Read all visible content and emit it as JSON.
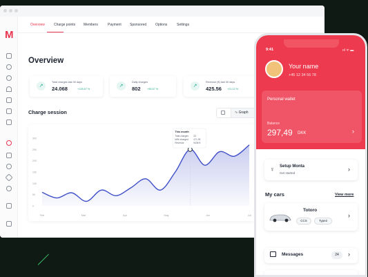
{
  "app": {
    "logo": "M",
    "tabs": [
      {
        "label": "Overview"
      },
      {
        "label": "Charge points"
      },
      {
        "label": "Members"
      },
      {
        "label": "Payment"
      },
      {
        "label": "Sponsored"
      },
      {
        "label": "Options"
      },
      {
        "label": "Settings"
      }
    ],
    "active_tab": "Overview"
  },
  "overview": {
    "title": "Overview",
    "cards": [
      {
        "label": "Total charges last 30 days",
        "value": "24.068",
        "change": "+126.67 %"
      },
      {
        "label": "Daily charges",
        "value": "802",
        "change": "+96.67 %"
      },
      {
        "label": "Revenue (€) last 30 days",
        "value": "425.56",
        "change": "+21.12 %"
      }
    ],
    "charge_session_title": "Charge session",
    "graph_label": "Graph"
  },
  "chart_data": {
    "type": "area",
    "x_labels": [
      "Feb",
      "Mar",
      "Apr",
      "May",
      "Jun",
      "Jul"
    ],
    "y_ticks": [
      "0",
      "50",
      "100",
      "150",
      "200",
      "250",
      "300"
    ],
    "ylim": [
      0,
      300
    ],
    "values": [
      60,
      35,
      58,
      20,
      70,
      45,
      80,
      120,
      70,
      150,
      250,
      180,
      240,
      220,
      270
    ],
    "tooltip": {
      "title": "This month",
      "rows": [
        {
          "label": "Total charges",
          "value": "23"
        },
        {
          "label": "kWh charged",
          "value": "471,93"
        },
        {
          "label": "Revenue",
          "value": "9436 €"
        }
      ]
    },
    "color": "#3d4dc8"
  },
  "phone": {
    "time": "9:41",
    "status": "ııl ᯤ ▬",
    "user_name": "Your name",
    "user_phone": "+45 12 34 56 78",
    "wallet_title": "Personal wallet",
    "balance_label": "Balance",
    "balance_value": "297,49",
    "balance_currency": "DKK",
    "setup_title": "Setup Monta",
    "setup_sub": "Get started",
    "my_cars": "My cars",
    "view_more": "View more",
    "car_name": "Totoro",
    "car_tags": [
      "CCS",
      "Type2"
    ],
    "messages_label": "Messages",
    "messages_count": "24",
    "accent": "#ee3a4e"
  }
}
